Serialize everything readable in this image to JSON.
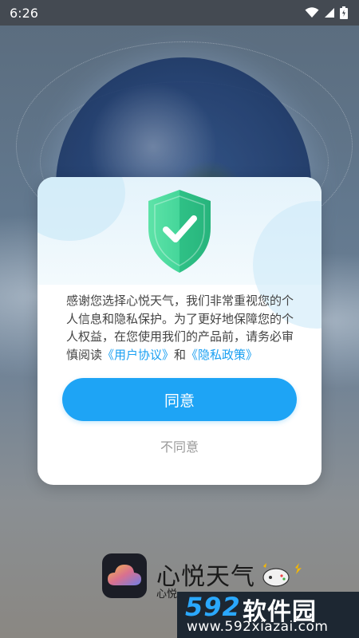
{
  "status_bar": {
    "time": "6:26"
  },
  "dialog": {
    "text_before_links": "感谢您选择心悦天气，我们非常重视您的个人信息和隐私保护。为了更好地保障您的个人权益，在您使用我们的产品前，请务必审慎阅读",
    "link_user_agreement": "《用户协议》",
    "text_and": "和",
    "link_privacy_policy": "《隐私政策》",
    "agree_label": "同意",
    "disagree_label": "不同意"
  },
  "brand": {
    "app_name": "心悦天气",
    "subtitle": "心悦"
  },
  "watermark": {
    "number": "592",
    "site_name": "软件园",
    "url": "www.592xiazai.com"
  },
  "colors": {
    "accent": "#1ea4f5",
    "shield_green": "#3fd39a",
    "link": "#1aa0f2"
  },
  "icons": [
    "wifi-icon",
    "signal-icon",
    "battery-icon",
    "shield-check-icon",
    "cloud-logo-icon",
    "game-controller-icon"
  ]
}
